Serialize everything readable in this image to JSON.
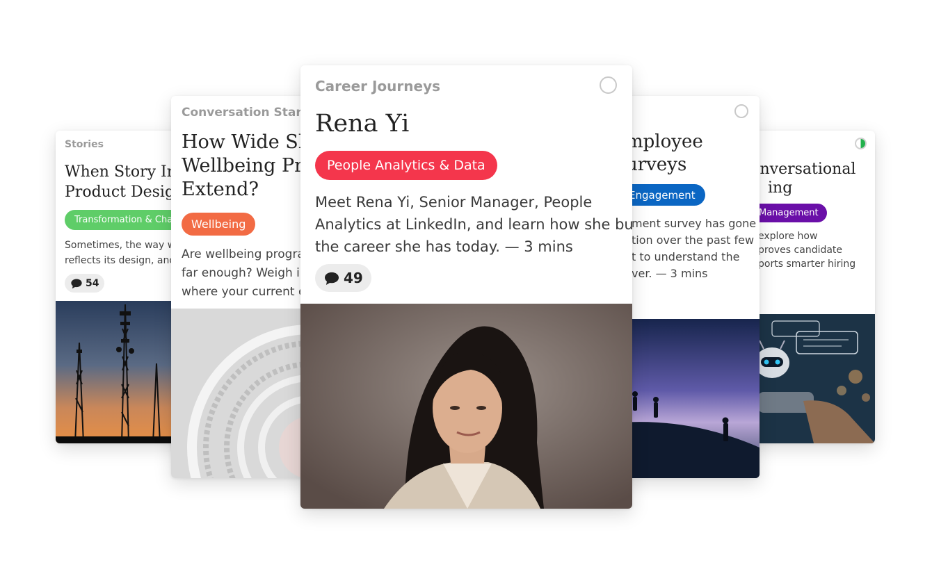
{
  "cards": [
    {
      "category": "Stories",
      "title_lines": [
        "When Story In",
        "Product Design"
      ],
      "tag": "Transformation & Chang",
      "tag_color": "#5fcd68",
      "desc_lines": [
        "Sometimes, the way we",
        "reflects its design, and t"
      ],
      "comments": "54",
      "image": "radio-towers-sunset"
    },
    {
      "category": "Conversation Starter",
      "title_lines": [
        "How Wide Sh",
        "Wellbeing Pro",
        "Extend?"
      ],
      "tag": "Wellbeing",
      "tag_color": "#f26b44",
      "desc_lines": [
        "Are wellbeing program",
        "far enough? Weigh in",
        "where your current eff"
      ],
      "image": "spiral-staircase"
    },
    {
      "category": "Career Journeys",
      "title_lines": [
        "Rena Yi"
      ],
      "tag": "People Analytics & Data",
      "tag_color": "#f4364c",
      "desc_lines": [
        "Meet Rena Yi, Senior Manager, People",
        "Analytics at LinkedIn, and learn how she built",
        "the career she has today. — 3 mins"
      ],
      "comments": "49",
      "image": "portrait-rena-yi"
    },
    {
      "title_lines": [
        "mployee",
        "urveys"
      ],
      "tag": "Engagement",
      "tag_color": "#0b66c3",
      "desc_lines": [
        "ment survey has gone",
        "tion over the past few",
        "t to understand the",
        "ver. — 3 mins"
      ],
      "image": "hikers-night-sky"
    },
    {
      "title_lines": [
        ": Conversational",
        "ing"
      ],
      "tag": "Management",
      "tag_color": "#6a0fa8",
      "desc_lines": [
        "explore how",
        "proves candidate",
        "ports smarter hiring"
      ],
      "image": "chatbot-robot-phone"
    }
  ],
  "icons": {
    "comment": "speech-bubble-icon",
    "select": "radio-circle-icon",
    "progress": "half-progress-icon"
  },
  "colors": {
    "progress_fill": "#22b14c",
    "category_text": "#9a9a9a"
  }
}
